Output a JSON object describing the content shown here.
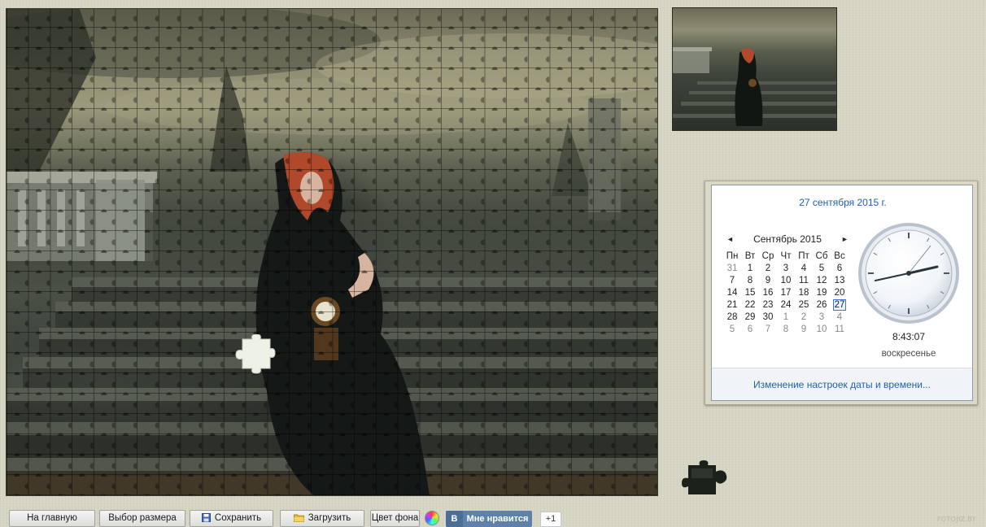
{
  "calendar_popup": {
    "date_link": "27 сентября 2015 г.",
    "month_title": "Сентябрь 2015",
    "prev_arrow": "◄",
    "next_arrow": "►",
    "weekdays": [
      "Пн",
      "Вт",
      "Ср",
      "Чт",
      "Пт",
      "Сб",
      "Вс"
    ],
    "weeks": [
      [
        "31",
        "1",
        "2",
        "3",
        "4",
        "5",
        "6"
      ],
      [
        "7",
        "8",
        "9",
        "10",
        "11",
        "12",
        "13"
      ],
      [
        "14",
        "15",
        "16",
        "17",
        "18",
        "19",
        "20"
      ],
      [
        "21",
        "22",
        "23",
        "24",
        "25",
        "26",
        "27"
      ],
      [
        "28",
        "29",
        "30",
        "1",
        "2",
        "3",
        "4"
      ],
      [
        "5",
        "6",
        "7",
        "8",
        "9",
        "10",
        "11"
      ]
    ],
    "selected_day": "27",
    "time": "8:43:07",
    "weekday_name": "воскресенье",
    "settings_link": "Изменение настроек даты и времени..."
  },
  "toolbar": {
    "home_label": "На главную",
    "size_label": "Выбор размера",
    "save_label": "Сохранить",
    "load_label": "Загрузить",
    "bg_color_label": "Цвет фона",
    "vk_logo": "В",
    "vk_like_label": "Мне нравится",
    "vk_count": "+1"
  },
  "watermark": "FOTOJIZ.BY",
  "icons": {
    "save": "floppy-disk-icon",
    "load": "folder-icon",
    "color": "color-wheel-icon",
    "vk": "vk-logo-icon"
  },
  "colors": {
    "page_bg": "#d7d5c4",
    "link": "#1e5ebd",
    "vk": "#5e81a8"
  }
}
